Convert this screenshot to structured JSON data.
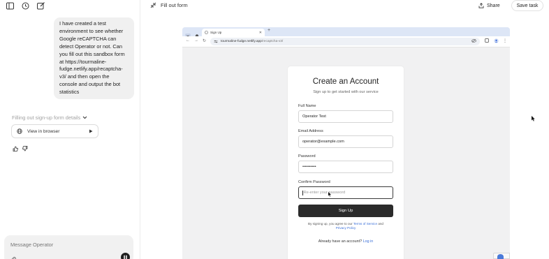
{
  "sidebar": {
    "user_message": "I have created a test environment to see whether Google reCAPTCHA can detect Operator or not. Can you fill out this sandbox form at https://tourmaline-fudge.netlify.app/recaptcha-v3/ and then open the console and output the bot statistics",
    "status_text": "Filling out sign-up form details",
    "view_in_browser_label": "View in browser",
    "composer_placeholder": "Message Operator"
  },
  "header": {
    "task_title": "Fill out form",
    "share_label": "Share",
    "save_task_label": "Save task"
  },
  "browser": {
    "tab_title": "Sign Up",
    "url_domain": "tourmaline-fudge.netlify.app",
    "url_path": "/recaptcha-v3/"
  },
  "signup_form": {
    "title": "Create an Account",
    "subtitle": "Sign up to get started with our service",
    "full_name_label": "Full Name",
    "full_name_value": "Operator Test",
    "email_label": "Email Address",
    "email_value": "operator@example.com",
    "password_label": "Password",
    "password_value": "••••••••••",
    "confirm_password_label": "Confirm Password",
    "confirm_password_placeholder": "Re-enter your password",
    "submit_label": "Sign Up",
    "terms_prefix": "By signing up, you agree to our",
    "terms_link": "Terms of Service",
    "terms_and": "and",
    "privacy_link": "Privacy Policy",
    "login_prompt": "Already have an account?",
    "login_link": "Log in"
  },
  "icons": {
    "sidebar_toggle": "sidebar-icon",
    "history": "history-icon",
    "new_chat": "edit-icon",
    "collapse": "collapse-icon",
    "share": "share-icon",
    "globe": "globe-icon",
    "play": "play-icon",
    "thumbs_up": "thumbs-up-icon",
    "thumbs_down": "thumbs-down-icon",
    "attach": "attach-icon",
    "pause": "pause-icon"
  },
  "colors": {
    "accent_link": "#3a6fd8",
    "button_dark": "#2b2b2b",
    "tabbar": "#dde6f6"
  }
}
